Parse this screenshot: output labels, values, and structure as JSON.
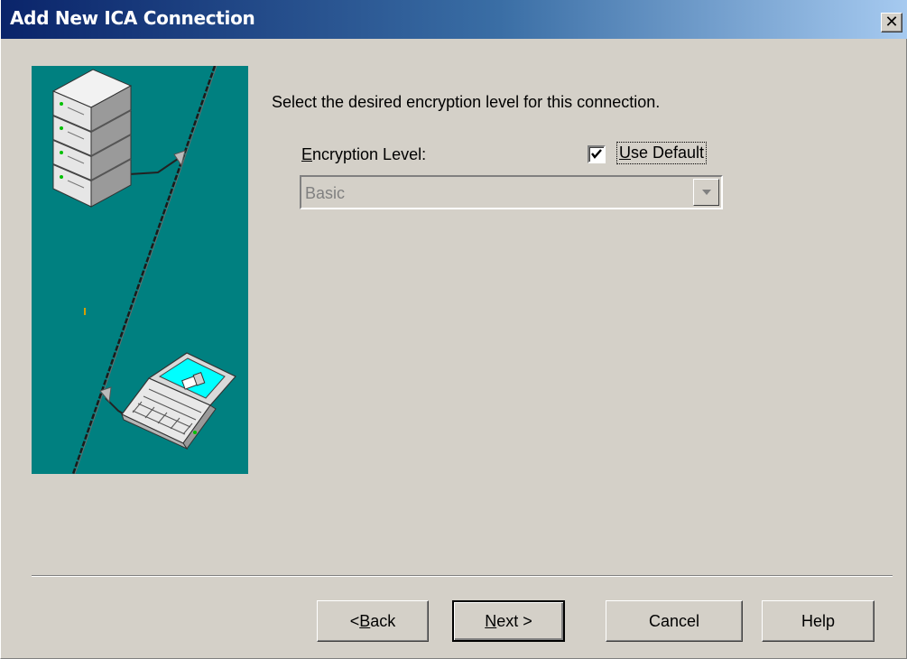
{
  "window": {
    "title": "Add New ICA Connection",
    "close_glyph": "✕"
  },
  "illustration": {
    "description_icons": [
      "server-stack-icon",
      "laptop-icon",
      "network-cable-icon"
    ],
    "background": "#008080"
  },
  "content": {
    "prompt": "Select the desired encryption level for this connection.",
    "encryption_label_mnemonic": "E",
    "encryption_label_rest": "ncryption Level:",
    "use_default_mnemonic": "U",
    "use_default_rest": "se Default",
    "use_default_checked": true,
    "encryption_value": "Basic",
    "encryption_enabled": false
  },
  "buttons": {
    "back_prefix": "< ",
    "back_mnemonic": "B",
    "back_rest": "ack",
    "next_mnemonic": "N",
    "next_rest": "ext >",
    "cancel": "Cancel",
    "help": "Help"
  },
  "colors": {
    "titlebar_start": "#0a246a",
    "titlebar_end": "#a6caf0",
    "dialog_bg": "#d4d0c8",
    "disabled_text": "#808080"
  }
}
